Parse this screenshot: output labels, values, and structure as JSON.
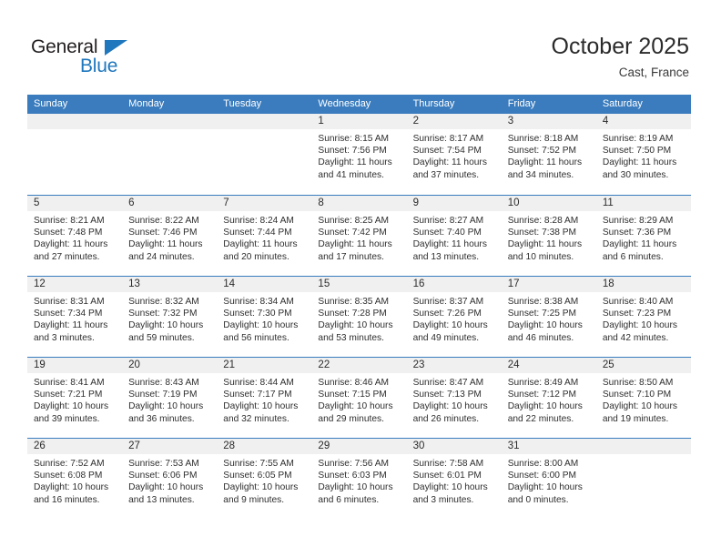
{
  "brand": {
    "name_part1": "General",
    "name_part2": "Blue",
    "accent_color": "#1f77bd"
  },
  "header": {
    "title": "October 2025",
    "subtitle": "Cast, France",
    "header_bg_color": "#3a7cbe",
    "day_strip_color": "#f0f0f0"
  },
  "weekdays": [
    "Sunday",
    "Monday",
    "Tuesday",
    "Wednesday",
    "Thursday",
    "Friday",
    "Saturday"
  ],
  "weeks": [
    [
      {
        "empty": true
      },
      {
        "empty": true
      },
      {
        "empty": true
      },
      {
        "day": "1",
        "sunrise": "Sunrise: 8:15 AM",
        "sunset": "Sunset: 7:56 PM",
        "daylight1": "Daylight: 11 hours",
        "daylight2": "and 41 minutes."
      },
      {
        "day": "2",
        "sunrise": "Sunrise: 8:17 AM",
        "sunset": "Sunset: 7:54 PM",
        "daylight1": "Daylight: 11 hours",
        "daylight2": "and 37 minutes."
      },
      {
        "day": "3",
        "sunrise": "Sunrise: 8:18 AM",
        "sunset": "Sunset: 7:52 PM",
        "daylight1": "Daylight: 11 hours",
        "daylight2": "and 34 minutes."
      },
      {
        "day": "4",
        "sunrise": "Sunrise: 8:19 AM",
        "sunset": "Sunset: 7:50 PM",
        "daylight1": "Daylight: 11 hours",
        "daylight2": "and 30 minutes."
      }
    ],
    [
      {
        "day": "5",
        "sunrise": "Sunrise: 8:21 AM",
        "sunset": "Sunset: 7:48 PM",
        "daylight1": "Daylight: 11 hours",
        "daylight2": "and 27 minutes."
      },
      {
        "day": "6",
        "sunrise": "Sunrise: 8:22 AM",
        "sunset": "Sunset: 7:46 PM",
        "daylight1": "Daylight: 11 hours",
        "daylight2": "and 24 minutes."
      },
      {
        "day": "7",
        "sunrise": "Sunrise: 8:24 AM",
        "sunset": "Sunset: 7:44 PM",
        "daylight1": "Daylight: 11 hours",
        "daylight2": "and 20 minutes."
      },
      {
        "day": "8",
        "sunrise": "Sunrise: 8:25 AM",
        "sunset": "Sunset: 7:42 PM",
        "daylight1": "Daylight: 11 hours",
        "daylight2": "and 17 minutes."
      },
      {
        "day": "9",
        "sunrise": "Sunrise: 8:27 AM",
        "sunset": "Sunset: 7:40 PM",
        "daylight1": "Daylight: 11 hours",
        "daylight2": "and 13 minutes."
      },
      {
        "day": "10",
        "sunrise": "Sunrise: 8:28 AM",
        "sunset": "Sunset: 7:38 PM",
        "daylight1": "Daylight: 11 hours",
        "daylight2": "and 10 minutes."
      },
      {
        "day": "11",
        "sunrise": "Sunrise: 8:29 AM",
        "sunset": "Sunset: 7:36 PM",
        "daylight1": "Daylight: 11 hours",
        "daylight2": "and 6 minutes."
      }
    ],
    [
      {
        "day": "12",
        "sunrise": "Sunrise: 8:31 AM",
        "sunset": "Sunset: 7:34 PM",
        "daylight1": "Daylight: 11 hours",
        "daylight2": "and 3 minutes."
      },
      {
        "day": "13",
        "sunrise": "Sunrise: 8:32 AM",
        "sunset": "Sunset: 7:32 PM",
        "daylight1": "Daylight: 10 hours",
        "daylight2": "and 59 minutes."
      },
      {
        "day": "14",
        "sunrise": "Sunrise: 8:34 AM",
        "sunset": "Sunset: 7:30 PM",
        "daylight1": "Daylight: 10 hours",
        "daylight2": "and 56 minutes."
      },
      {
        "day": "15",
        "sunrise": "Sunrise: 8:35 AM",
        "sunset": "Sunset: 7:28 PM",
        "daylight1": "Daylight: 10 hours",
        "daylight2": "and 53 minutes."
      },
      {
        "day": "16",
        "sunrise": "Sunrise: 8:37 AM",
        "sunset": "Sunset: 7:26 PM",
        "daylight1": "Daylight: 10 hours",
        "daylight2": "and 49 minutes."
      },
      {
        "day": "17",
        "sunrise": "Sunrise: 8:38 AM",
        "sunset": "Sunset: 7:25 PM",
        "daylight1": "Daylight: 10 hours",
        "daylight2": "and 46 minutes."
      },
      {
        "day": "18",
        "sunrise": "Sunrise: 8:40 AM",
        "sunset": "Sunset: 7:23 PM",
        "daylight1": "Daylight: 10 hours",
        "daylight2": "and 42 minutes."
      }
    ],
    [
      {
        "day": "19",
        "sunrise": "Sunrise: 8:41 AM",
        "sunset": "Sunset: 7:21 PM",
        "daylight1": "Daylight: 10 hours",
        "daylight2": "and 39 minutes."
      },
      {
        "day": "20",
        "sunrise": "Sunrise: 8:43 AM",
        "sunset": "Sunset: 7:19 PM",
        "daylight1": "Daylight: 10 hours",
        "daylight2": "and 36 minutes."
      },
      {
        "day": "21",
        "sunrise": "Sunrise: 8:44 AM",
        "sunset": "Sunset: 7:17 PM",
        "daylight1": "Daylight: 10 hours",
        "daylight2": "and 32 minutes."
      },
      {
        "day": "22",
        "sunrise": "Sunrise: 8:46 AM",
        "sunset": "Sunset: 7:15 PM",
        "daylight1": "Daylight: 10 hours",
        "daylight2": "and 29 minutes."
      },
      {
        "day": "23",
        "sunrise": "Sunrise: 8:47 AM",
        "sunset": "Sunset: 7:13 PM",
        "daylight1": "Daylight: 10 hours",
        "daylight2": "and 26 minutes."
      },
      {
        "day": "24",
        "sunrise": "Sunrise: 8:49 AM",
        "sunset": "Sunset: 7:12 PM",
        "daylight1": "Daylight: 10 hours",
        "daylight2": "and 22 minutes."
      },
      {
        "day": "25",
        "sunrise": "Sunrise: 8:50 AM",
        "sunset": "Sunset: 7:10 PM",
        "daylight1": "Daylight: 10 hours",
        "daylight2": "and 19 minutes."
      }
    ],
    [
      {
        "day": "26",
        "sunrise": "Sunrise: 7:52 AM",
        "sunset": "Sunset: 6:08 PM",
        "daylight1": "Daylight: 10 hours",
        "daylight2": "and 16 minutes."
      },
      {
        "day": "27",
        "sunrise": "Sunrise: 7:53 AM",
        "sunset": "Sunset: 6:06 PM",
        "daylight1": "Daylight: 10 hours",
        "daylight2": "and 13 minutes."
      },
      {
        "day": "28",
        "sunrise": "Sunrise: 7:55 AM",
        "sunset": "Sunset: 6:05 PM",
        "daylight1": "Daylight: 10 hours",
        "daylight2": "and 9 minutes."
      },
      {
        "day": "29",
        "sunrise": "Sunrise: 7:56 AM",
        "sunset": "Sunset: 6:03 PM",
        "daylight1": "Daylight: 10 hours",
        "daylight2": "and 6 minutes."
      },
      {
        "day": "30",
        "sunrise": "Sunrise: 7:58 AM",
        "sunset": "Sunset: 6:01 PM",
        "daylight1": "Daylight: 10 hours",
        "daylight2": "and 3 minutes."
      },
      {
        "day": "31",
        "sunrise": "Sunrise: 8:00 AM",
        "sunset": "Sunset: 6:00 PM",
        "daylight1": "Daylight: 10 hours",
        "daylight2": "and 0 minutes."
      },
      {
        "empty": true
      }
    ]
  ]
}
